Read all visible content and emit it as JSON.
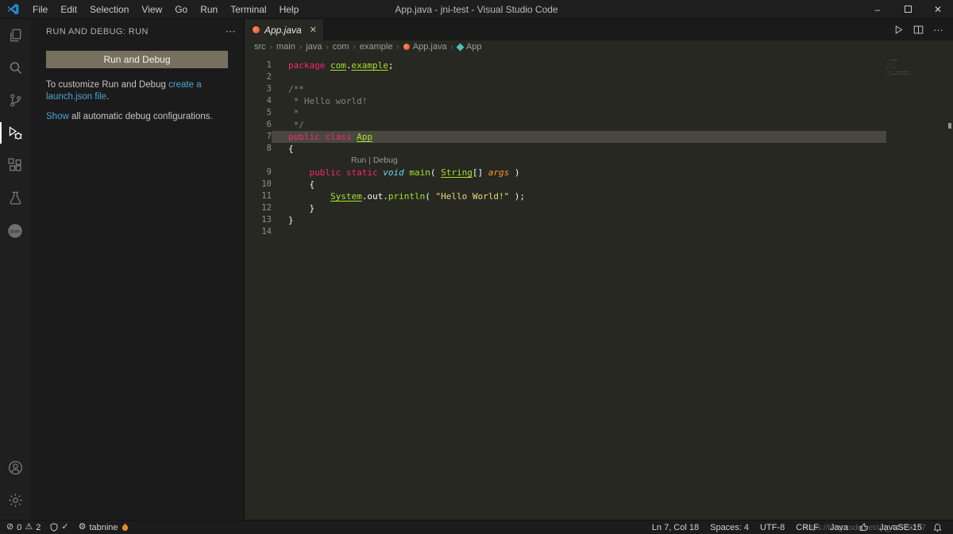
{
  "palette": {
    "editor_bg": "#272822",
    "sidebar_bg": "#1b1b1b",
    "activitybar_bg": "#1f1f1f",
    "titlebar_bg": "#1e1e1e",
    "tabbar_bg": "#1a1a1a",
    "statusbar_bg": "#1c1c1c",
    "accent_link": "#4ba3d9",
    "button_bg": "#75715e",
    "line_highlight": "#49483e",
    "kw": "#f92672",
    "fn": "#a6e22e",
    "typ": "#66d9ef",
    "arg": "#fd971f",
    "str": "#e6db74",
    "cmt": "#88846f",
    "pln": "#f8f8f2",
    "gutter": "#90908a"
  },
  "glyphs": {
    "close": "✕",
    "more": "⋯",
    "minimize": "–",
    "ellipsis": "···",
    "chevron": "›",
    "check": "✓",
    "warning": "⚠",
    "error": "⊘",
    "gear": "⚙"
  },
  "window": {
    "title": "App.java - jni-test - Visual Studio Code"
  },
  "menubar": [
    "File",
    "Edit",
    "Selection",
    "View",
    "Go",
    "Run",
    "Terminal",
    "Help"
  ],
  "activity_bar": {
    "top": [
      {
        "id": "explorer",
        "icon": "files-icon",
        "active": false
      },
      {
        "id": "search",
        "icon": "search-icon",
        "active": false
      },
      {
        "id": "source-control",
        "icon": "source-control-icon",
        "active": false
      },
      {
        "id": "run-and-debug",
        "icon": "run-debug-icon",
        "active": true
      },
      {
        "id": "extensions",
        "icon": "extensions-icon",
        "active": false
      },
      {
        "id": "testing",
        "icon": "beaker-icon",
        "active": false
      },
      {
        "id": "json-viewer",
        "icon": "json-icon",
        "active": false
      }
    ],
    "bottom": [
      {
        "id": "accounts",
        "icon": "account-icon",
        "active": false
      },
      {
        "id": "settings",
        "icon": "gear-icon",
        "active": false
      }
    ]
  },
  "sidebar": {
    "title": "RUN AND DEBUG: RUN",
    "run_button": "Run and Debug",
    "customize_prefix": "To customize Run and Debug ",
    "customize_link": "create a launch.json file",
    "customize_suffix": ".",
    "show_link": "Show",
    "show_suffix": " all automatic debug configurations."
  },
  "editor": {
    "tab": {
      "label": "App.java"
    },
    "breadcrumbs": [
      {
        "label": "src"
      },
      {
        "label": "main"
      },
      {
        "label": "java"
      },
      {
        "label": "com"
      },
      {
        "label": "example"
      },
      {
        "label": "App.java",
        "icon": "java-file-icon"
      },
      {
        "label": "App",
        "icon": "class-symbol-icon"
      }
    ],
    "codelens": {
      "run": "Run",
      "sep": " | ",
      "debug": "Debug"
    },
    "lines": [
      {
        "num": 1,
        "tokens": [
          [
            "kw",
            "package"
          ],
          [
            "pln",
            " "
          ],
          [
            "ns",
            "com"
          ],
          [
            "pln",
            "."
          ],
          [
            "ns",
            "example"
          ],
          [
            "pln",
            ";"
          ]
        ]
      },
      {
        "num": 2,
        "tokens": []
      },
      {
        "num": 3,
        "tokens": [
          [
            "cmt",
            "/**"
          ]
        ]
      },
      {
        "num": 4,
        "tokens": [
          [
            "cmt",
            " * Hello world!"
          ]
        ]
      },
      {
        "num": 5,
        "tokens": [
          [
            "cmt",
            " *"
          ]
        ]
      },
      {
        "num": 6,
        "tokens": [
          [
            "cmt",
            " */"
          ]
        ]
      },
      {
        "num": 7,
        "hl": true,
        "tokens": [
          [
            "kw",
            "public class"
          ],
          [
            "pln",
            " "
          ],
          [
            "cls",
            "App"
          ]
        ]
      },
      {
        "num": 8,
        "tokens": [
          [
            "pln",
            "{"
          ]
        ]
      },
      {
        "num": 9,
        "codelens": true,
        "tokens": [
          [
            "pln",
            "    "
          ],
          [
            "kw",
            "public static"
          ],
          [
            "pln",
            " "
          ],
          [
            "typ",
            "void"
          ],
          [
            "pln",
            " "
          ],
          [
            "fn",
            "main"
          ],
          [
            "pln",
            "( "
          ],
          [
            "cls",
            "String"
          ],
          [
            "pln",
            "[] "
          ],
          [
            "arg",
            "args"
          ],
          [
            "pln",
            " )"
          ]
        ]
      },
      {
        "num": 10,
        "tokens": [
          [
            "pln",
            "    {"
          ]
        ]
      },
      {
        "num": 11,
        "tokens": [
          [
            "pln",
            "        "
          ],
          [
            "cls",
            "System"
          ],
          [
            "pln",
            ".out."
          ],
          [
            "fn",
            "println"
          ],
          [
            "pln",
            "( "
          ],
          [
            "str",
            "\"Hello World!\""
          ],
          [
            "pln",
            " );"
          ]
        ]
      },
      {
        "num": 12,
        "tokens": [
          [
            "pln",
            "    }"
          ]
        ]
      },
      {
        "num": 13,
        "tokens": [
          [
            "pln",
            "}"
          ]
        ]
      },
      {
        "num": 14,
        "tokens": []
      }
    ]
  },
  "status_bar": {
    "left": [
      {
        "id": "problems",
        "parts": [
          {
            "glyph": "error"
          },
          {
            "text": "0"
          },
          {
            "glyph": "warning"
          },
          {
            "text": "2"
          }
        ]
      },
      {
        "id": "status-check",
        "parts": [
          {
            "icon": "shield-icon"
          },
          {
            "glyph": "check"
          }
        ]
      },
      {
        "id": "tabnine",
        "parts": [
          {
            "glyph": "gear"
          },
          {
            "text": "tabnine"
          },
          {
            "icon": "flame-icon"
          }
        ]
      }
    ],
    "right": [
      {
        "id": "cursor-position",
        "parts": [
          {
            "text": "Ln 7, Col 18"
          }
        ]
      },
      {
        "id": "indentation",
        "parts": [
          {
            "text": "Spaces: 4"
          }
        ]
      },
      {
        "id": "encoding",
        "parts": [
          {
            "text": "UTF-8"
          }
        ]
      },
      {
        "id": "eol",
        "parts": [
          {
            "text": "CRLF"
          }
        ]
      },
      {
        "id": "language-mode",
        "parts": [
          {
            "text": "Java"
          }
        ]
      },
      {
        "id": "java-status",
        "parts": [
          {
            "icon": "thumbsup-icon"
          }
        ]
      },
      {
        "id": "java-runtime",
        "parts": [
          {
            "text": "JavaSE-15"
          }
        ]
      },
      {
        "id": "notifications",
        "parts": [
          {
            "icon": "bell-icon"
          }
        ]
      }
    ]
  },
  "watermark": {
    "text": "https://blog.csdn.net/qq_44523267"
  }
}
